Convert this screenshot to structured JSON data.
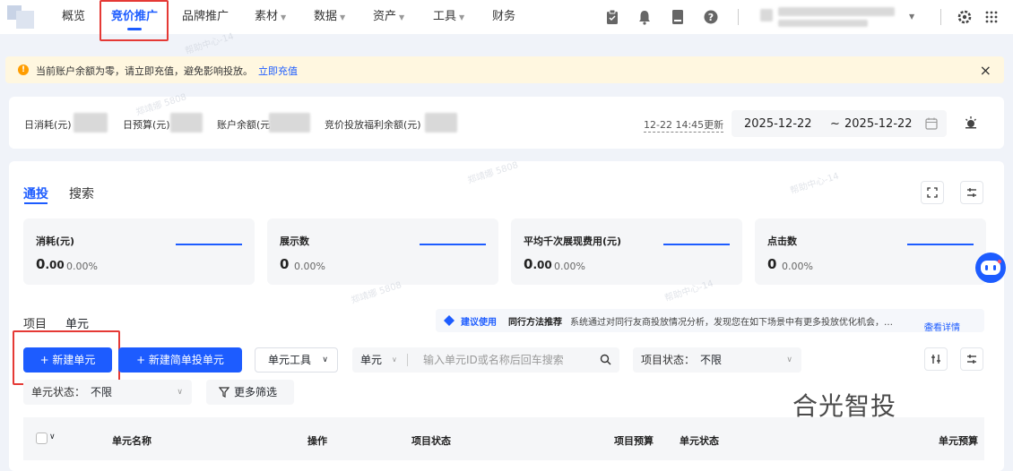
{
  "nav": {
    "items": [
      {
        "label": "概览",
        "caret": false
      },
      {
        "label": "竞价推广",
        "caret": false,
        "active": true
      },
      {
        "label": "品牌推广",
        "caret": false
      },
      {
        "label": "素材",
        "caret": true
      },
      {
        "label": "数据",
        "caret": true
      },
      {
        "label": "资产",
        "caret": true
      },
      {
        "label": "工具",
        "caret": true
      },
      {
        "label": "财务",
        "caret": false
      }
    ],
    "accent": "#1d5cff",
    "highlight": "#e53935",
    "icons": [
      "clipboard-icon",
      "bell-icon",
      "document-icon",
      "help-icon",
      "settings-icon",
      "app-grid-icon"
    ]
  },
  "alert": {
    "message": "当前账户余额为零，请立即充值，避免影响投放。",
    "link": "立即充值",
    "close": "×"
  },
  "stats": {
    "daily_spend": "日消耗(元)",
    "daily_budget": "日预算(元)",
    "balance": "账户余额(元)",
    "welfare_balance": "竞价投放福利余额(元)",
    "updated": "12-22 14:45更新",
    "date_start": "2025-12-22",
    "date_sep": "~",
    "date_end": "2025-12-22"
  },
  "tabs": {
    "t1": "通投",
    "t2": "搜索"
  },
  "metrics": [
    {
      "label": "消耗(元)",
      "int": "0",
      "dec": ".00",
      "pct": "0.00%"
    },
    {
      "label": "展示数",
      "int": "0",
      "dec": "",
      "pct": "0.00%"
    },
    {
      "label": "平均千次展现费用(元)",
      "int": "0",
      "dec": ".00",
      "pct": "0.00%"
    },
    {
      "label": "点击数",
      "int": "0",
      "dec": "",
      "pct": "0.00%"
    }
  ],
  "subtabs": {
    "project": "项目",
    "unit": "单元"
  },
  "suggest": {
    "tag": "建议使用",
    "title": "同行方法推荐",
    "text": "系统通过对同行友商投放情况分析，发现您在如下场景中有更多投放优化机会，…",
    "link": "查看详情"
  },
  "toolbar": {
    "new_unit": "+ 新建单元",
    "new_simple_unit": "+ 新建简单投单元",
    "unit_tools": "单元工具",
    "search_scope": "单元",
    "search_placeholder": "输入单元ID或名称后回车搜索",
    "project_status_label": "项目状态：",
    "project_status_value": "不限",
    "unit_status_label": "单元状态：",
    "unit_status_value": "不限",
    "more_filters": "更多筛选"
  },
  "table": {
    "columns": [
      "单元名称",
      "操作",
      "项目状态",
      "项目预算",
      "单元状态",
      "单元预算"
    ]
  },
  "watermark": {
    "brand": "合光智投",
    "line1": "郑靖娜 5808",
    "line2": "帮助中心-14"
  }
}
